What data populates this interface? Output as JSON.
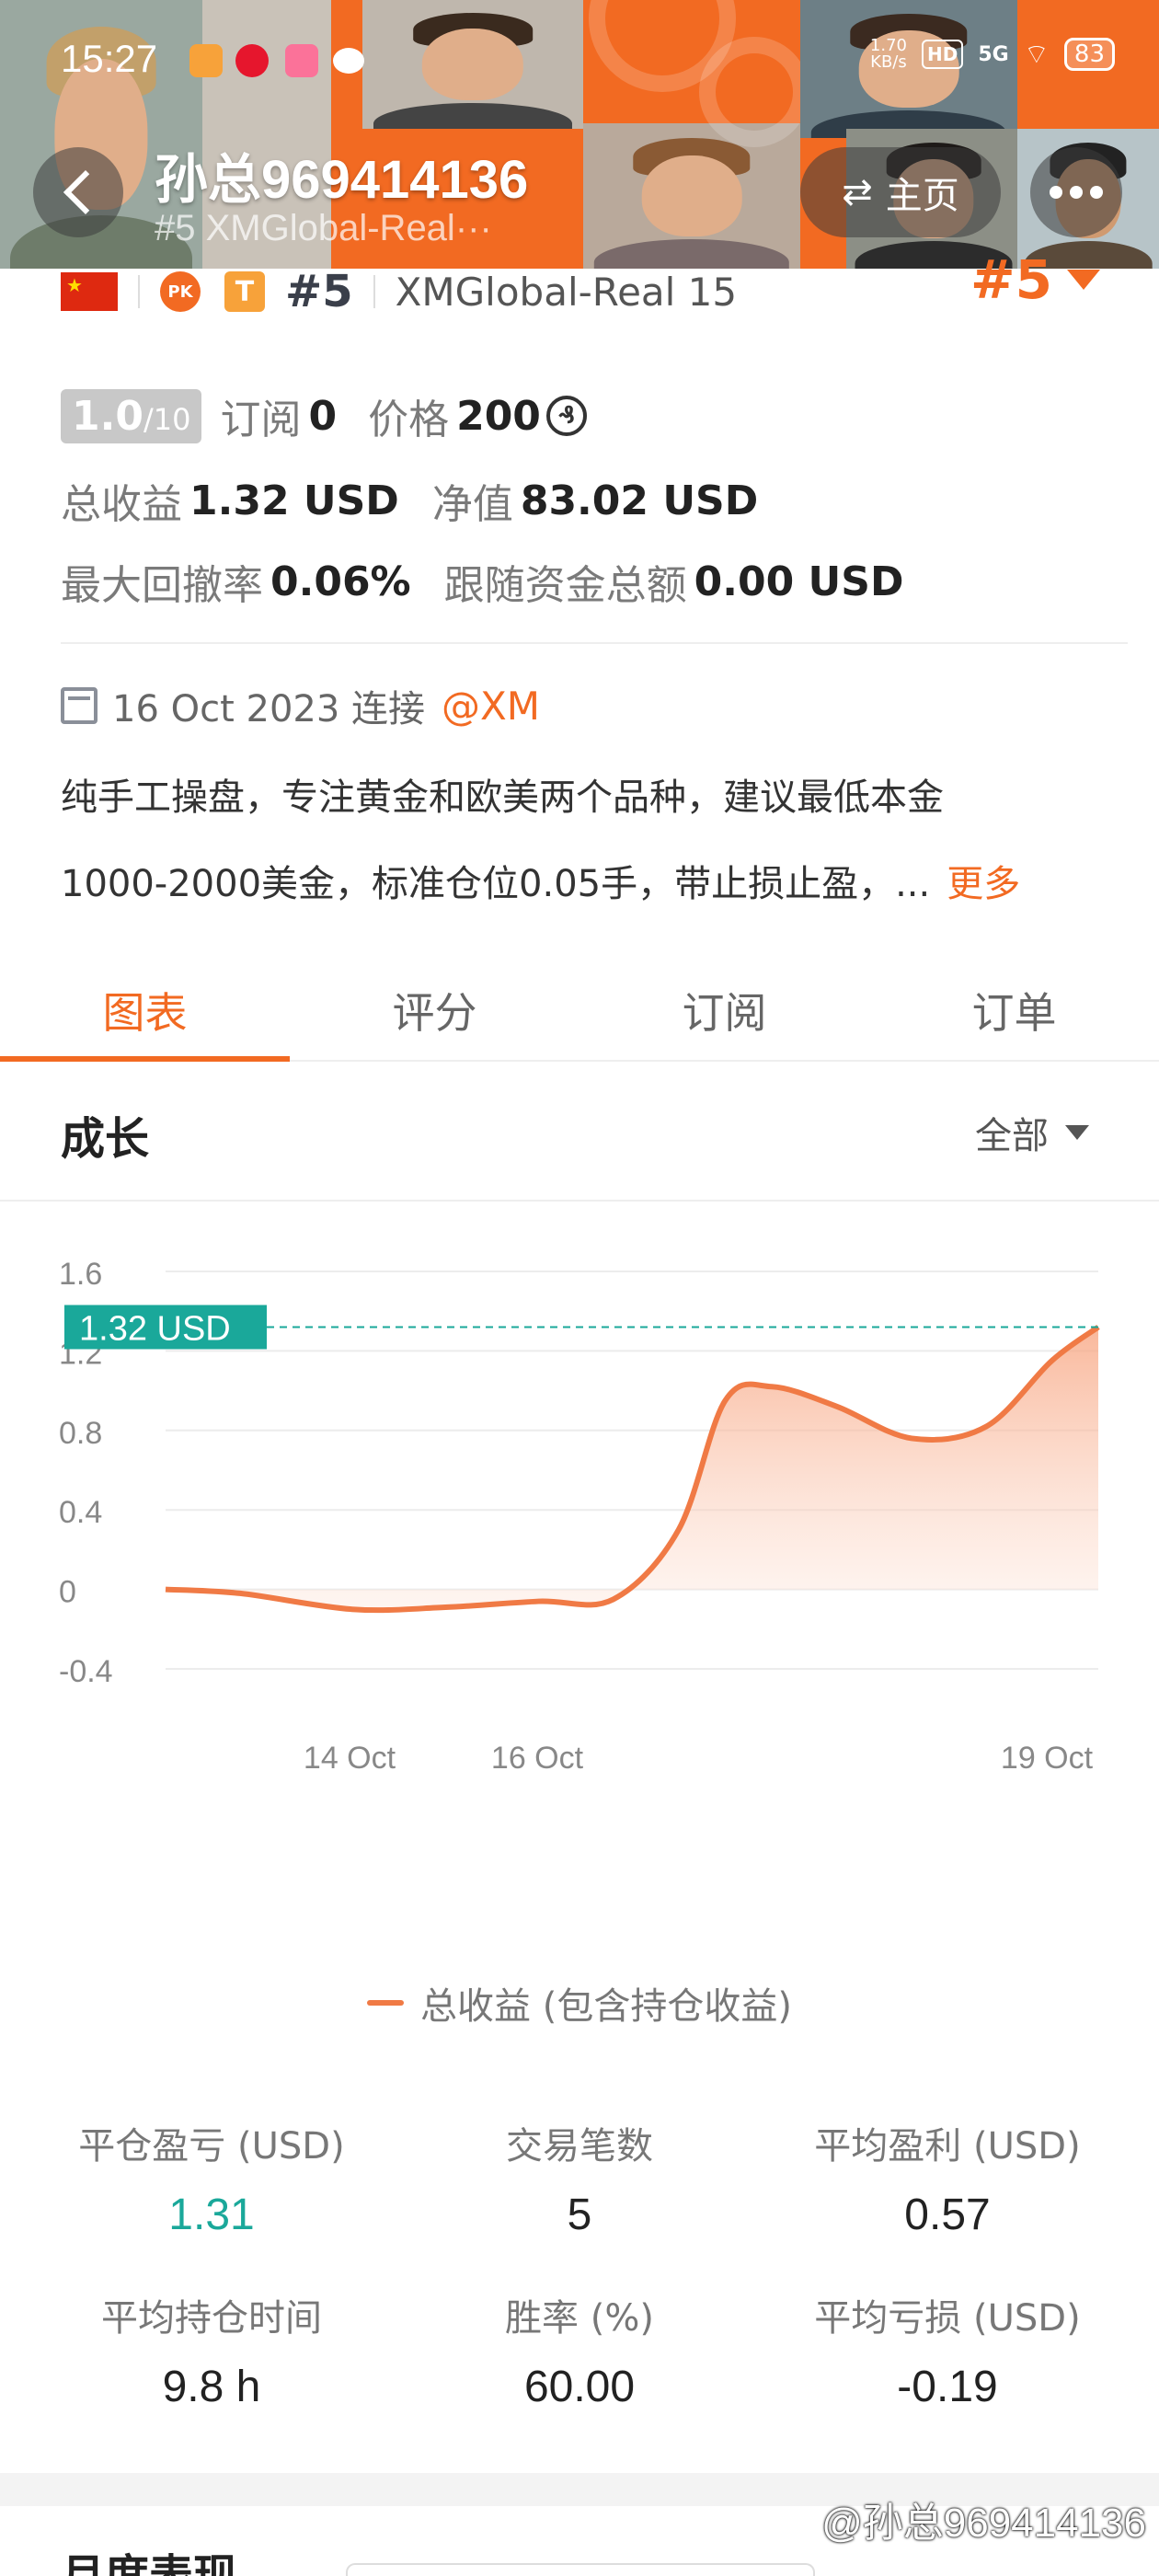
{
  "status_bar": {
    "time": "15:27",
    "net_speed_value": "1.70",
    "net_speed_unit": "KB/s",
    "hd": "HD",
    "signal": "5G",
    "battery": "83"
  },
  "header": {
    "title": "孙总969414136",
    "subtitle": "#5  XMGlobal-Real···",
    "home_label": "主页"
  },
  "profile": {
    "pk_badge": "PK",
    "t_badge": "T",
    "rank": "#5",
    "account": "XMGlobal-Real 15",
    "rank_right": "#5",
    "score": "1.0",
    "score_max": "/10",
    "subscribe_label": "订阅",
    "subscribe_value": "0",
    "price_label": "价格",
    "price_value": "200",
    "coin_symbol": "₰",
    "total_profit_label": "总收益",
    "total_profit_value": "1.32 USD",
    "equity_label": "净值",
    "equity_value": "83.02 USD",
    "max_drawdown_label": "最大回撤率",
    "max_drawdown_value": "0.06%",
    "follow_funds_label": "跟随资金总额",
    "follow_funds_value": "0.00 USD",
    "connect_date": "16 Oct 2023 连接",
    "broker": "@XM",
    "description_line1": "纯手工操盘，专注黄金和欧美两个品种，建议最低本金",
    "description_line2": "1000-2000美金，标准仓位0.05手，带止损止盈，...",
    "more": "更多"
  },
  "tabs": [
    {
      "label": "图表",
      "active": true
    },
    {
      "label": "评分",
      "active": false
    },
    {
      "label": "订阅",
      "active": false
    },
    {
      "label": "订单",
      "active": false
    }
  ],
  "growth": {
    "title": "成长",
    "filter": "全部"
  },
  "chart_data": {
    "type": "area",
    "current_value_label": "1.32 USD",
    "ylim": [
      -0.4,
      1.6
    ],
    "y_ticks": [
      "1.6",
      "1.2",
      "0.8",
      "0.4",
      "0",
      "-0.4"
    ],
    "x_ticks": [
      "14 Oct",
      "16 Oct",
      "19 Oct"
    ],
    "series": [
      {
        "name": "总收益 (包含持仓收益)",
        "color": "#f07a45",
        "points": [
          [
            0,
            0.0
          ],
          [
            0.08,
            -0.02
          ],
          [
            0.2,
            -0.1
          ],
          [
            0.3,
            -0.09
          ],
          [
            0.4,
            -0.06
          ],
          [
            0.48,
            -0.05
          ],
          [
            0.55,
            0.3
          ],
          [
            0.6,
            0.95
          ],
          [
            0.65,
            1.02
          ],
          [
            0.72,
            0.92
          ],
          [
            0.8,
            0.76
          ],
          [
            0.88,
            0.82
          ],
          [
            0.95,
            1.15
          ],
          [
            1.0,
            1.32
          ]
        ]
      }
    ],
    "grid": true
  },
  "stats": [
    {
      "label": "平仓盈亏 (USD)",
      "value": "1.31",
      "color": "green"
    },
    {
      "label": "交易笔数",
      "value": "5",
      "color": ""
    },
    {
      "label": "平均盈利 (USD)",
      "value": "0.57",
      "color": ""
    },
    {
      "label": "平均持仓时间",
      "value": "9.8 h",
      "color": ""
    },
    {
      "label": "胜率 (%)",
      "value": "60.00",
      "color": ""
    },
    {
      "label": "平均亏损 (USD)",
      "value": "-0.19",
      "color": ""
    }
  ],
  "bottom_section_title": "月度表现",
  "watermark": "@孙总969414136"
}
